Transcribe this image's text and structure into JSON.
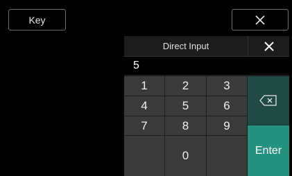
{
  "top_bar": {
    "key_label": "Key",
    "close_icon": "close-icon"
  },
  "direct_input": {
    "title": "Direct Input",
    "close_icon": "close-icon",
    "value": "5",
    "keys": [
      "1",
      "2",
      "3",
      "4",
      "5",
      "6",
      "7",
      "8",
      "9",
      "0"
    ],
    "backspace_icon": "backspace-icon",
    "enter_label": "Enter",
    "colors": {
      "enter": "#23927f",
      "backspace": "#1f4a45",
      "key": "#3a3a3a"
    }
  }
}
